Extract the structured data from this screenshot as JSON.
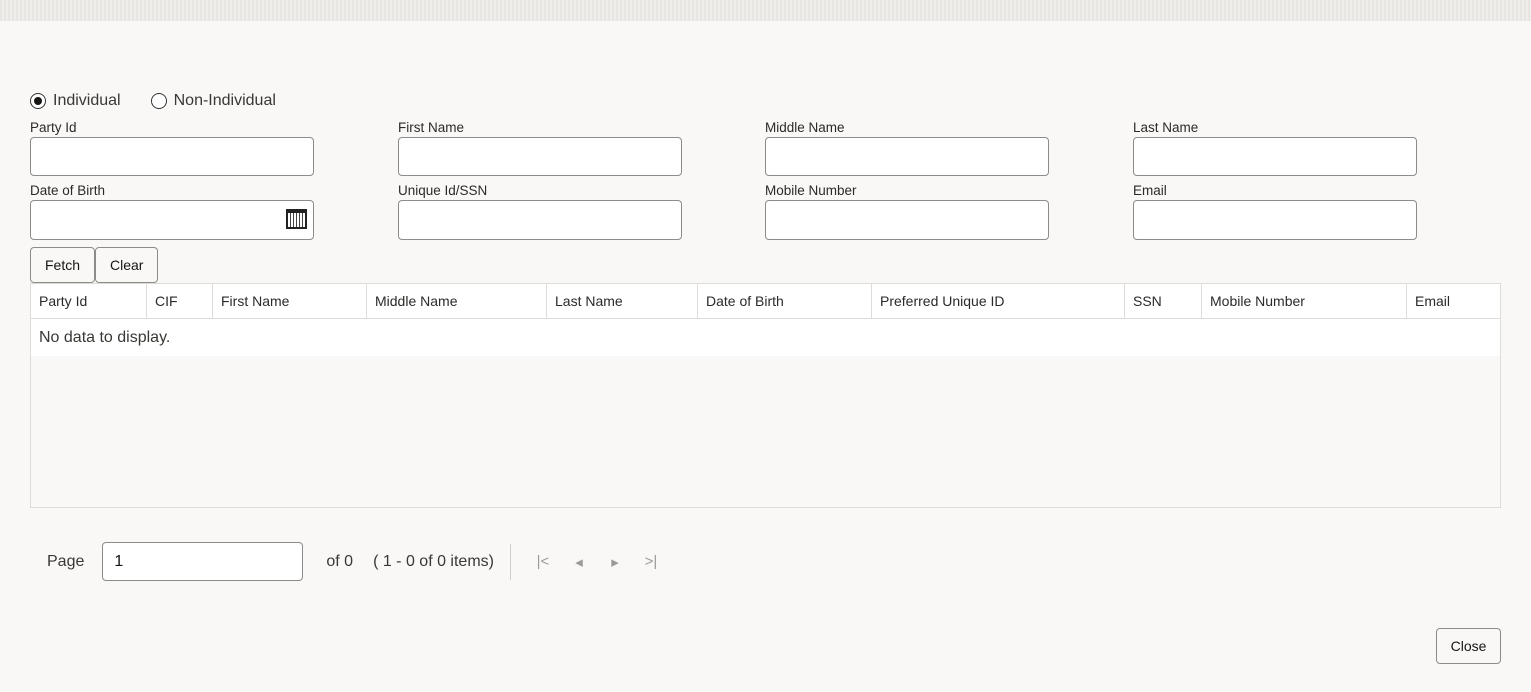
{
  "party_type": {
    "options": [
      "Individual",
      "Non-Individual"
    ],
    "selected": "Individual"
  },
  "fields": [
    {
      "label": "Party Id",
      "value": ""
    },
    {
      "label": "First Name",
      "value": ""
    },
    {
      "label": "Middle Name",
      "value": ""
    },
    {
      "label": "Last Name",
      "value": ""
    },
    {
      "label": "Date of Birth",
      "value": ""
    },
    {
      "label": "Unique Id/SSN",
      "value": ""
    },
    {
      "label": "Mobile Number",
      "value": ""
    },
    {
      "label": "Email",
      "value": ""
    }
  ],
  "buttons": {
    "fetch": "Fetch",
    "clear": "Clear",
    "close": "Close"
  },
  "table": {
    "columns": [
      "Party Id",
      "CIF",
      "First Name",
      "Middle Name",
      "Last Name",
      "Date of Birth",
      "Preferred Unique ID",
      "SSN",
      "Mobile Number",
      "Email"
    ],
    "empty_text": "No data to display."
  },
  "pager": {
    "label": "Page",
    "page": "1",
    "of": "of 0",
    "range": "( 1 - 0 of 0 items)",
    "nav": {
      "first": "|<",
      "prev": "◂",
      "next": "▸",
      "last": ">|"
    }
  }
}
